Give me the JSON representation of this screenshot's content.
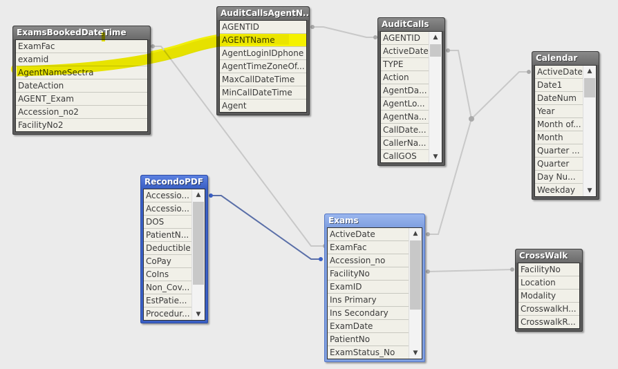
{
  "tables": {
    "exams_booked": {
      "title": "ExamsBookedDateTime",
      "fields": [
        "ExamFac",
        "examid",
        "AgentNameSectra",
        "DateAction",
        "AGENT_Exam",
        "Accession_no2",
        "FacilityNo2"
      ],
      "highlighted_field": "AgentNameSectra"
    },
    "audit_calls_agent": {
      "title": "AuditCallsAgentN...",
      "fields": [
        "AGENTID",
        "AGENTName",
        "AgentLoginIDphone",
        "AgentTimeZoneOf...",
        "MaxCallDateTime",
        "MinCallDateTime",
        "Agent"
      ],
      "highlighted_field": "AGENTName"
    },
    "audit_calls": {
      "title": "AuditCalls",
      "fields": [
        "AGENTID",
        "ActiveDate",
        "TYPE",
        "Action",
        "AgentDa...",
        "AgentLo...",
        "AgentNa...",
        "CallDate...",
        "CallerNa...",
        "CallGOS"
      ]
    },
    "calendar": {
      "title": "Calendar",
      "fields": [
        "ActiveDate",
        "Date1",
        "DateNum",
        "Year",
        "Month of...",
        "Month",
        "Quarter ...",
        "Quarter",
        "Day Nu...",
        "Weekday"
      ]
    },
    "recondo_pdf": {
      "title": "RecondoPDF",
      "fields": [
        "Accessio...",
        "Accessio...",
        "DOS",
        "PatientN...",
        "Deductible",
        "CoPay",
        "CoIns",
        "Non_Cov...",
        "EstPatie...",
        "Procedur..."
      ]
    },
    "exams": {
      "title": "Exams",
      "fields": [
        "ActiveDate",
        "ExamFac",
        "Accession_no",
        "FacilityNo",
        "ExamID",
        "Ins Primary",
        "Ins Secondary",
        "ExamDate",
        "PatientNo",
        "ExamStatus_No"
      ]
    },
    "crosswalk": {
      "title": "CrossWalk",
      "fields": [
        "FacilityNo",
        "Location",
        "Modality",
        "CrosswalkH...",
        "CrosswalkR..."
      ]
    }
  },
  "icons": {
    "scroll_up": "▲",
    "scroll_down": "▼"
  },
  "colors": {
    "link": "#c8c8c8",
    "active_link": "#5a6fa8",
    "highlight": "#f5f200"
  }
}
